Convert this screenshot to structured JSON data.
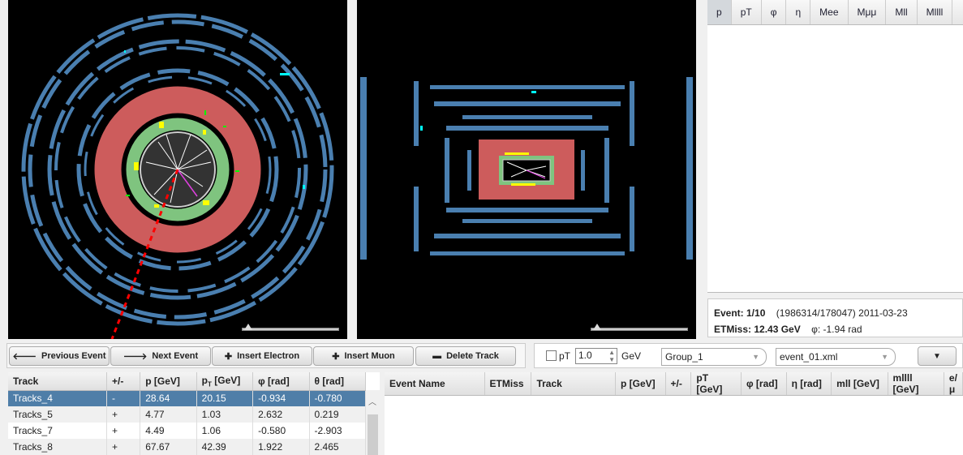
{
  "views": {
    "transverse": "atlas-transverse-view",
    "longitudinal": "atlas-longitudinal-view"
  },
  "histogram_tabs": [
    "p",
    "pT",
    "φ",
    "η",
    "Mee",
    "Mμμ",
    "Mll",
    "Mllll"
  ],
  "selected_tab": "p",
  "event_info": {
    "event_label": "Event: 1/10",
    "run_info": "(1986314/178047) 2011-03-23",
    "etmiss_label": "ETMiss: 12.43 GeV",
    "phi_label": "φ: -1.94 rad"
  },
  "toolbar": {
    "previous": "Previous Event",
    "next": "Next Event",
    "insert_electron": "Insert Electron",
    "insert_muon": "Insert Muon",
    "delete_track": "Delete Track",
    "pt_filter_label": "pT",
    "pt_value": "1.0",
    "pt_unit": "GeV",
    "pt_checked": false,
    "group": "Group_1",
    "file": "event_01.xml",
    "menu": "▼"
  },
  "track_table": {
    "columns": [
      "Track",
      "+/-",
      "p [GeV]",
      "pT [GeV]",
      "φ [rad]",
      "θ [rad]"
    ],
    "rows": [
      [
        "Tracks_4",
        "-",
        "28.64",
        "20.15",
        "-0.934",
        "-0.780"
      ],
      [
        "Tracks_5",
        "+",
        "4.77",
        "1.03",
        "2.632",
        "0.219"
      ],
      [
        "Tracks_7",
        "+",
        "4.49",
        "1.06",
        "-0.580",
        "-2.903"
      ],
      [
        "Tracks_8",
        "+",
        "67.67",
        "42.39",
        "1.922",
        "2.465"
      ]
    ],
    "selected_row": 0
  },
  "event_table": {
    "columns": [
      "Event Name",
      "ETMiss",
      "Track",
      "p [GeV]",
      "+/-",
      "pT [GeV]",
      "φ [rad]",
      "η [rad]",
      "mll [GeV]",
      "mllll [GeV]",
      "e/μ"
    ]
  },
  "colors": {
    "selection": "#4f7ea8",
    "muon_chamber": "#4a7fb0",
    "calorimeter_had": "#cd5c5c",
    "calorimeter_em": "#7fc47f",
    "missing_et": "#ff0000"
  }
}
